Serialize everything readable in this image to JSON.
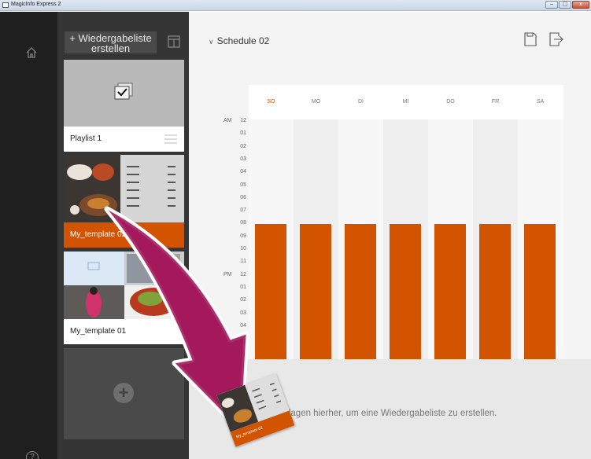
{
  "window": {
    "title": "MagicInfo Express 2",
    "buttons": [
      "–",
      "▢",
      "x"
    ]
  },
  "rail": {
    "home_icon": "home-icon",
    "help_label": "?"
  },
  "playlists": {
    "add_label": "+ Wiedergabeliste erstellen",
    "items": [
      {
        "label": "Playlist 1"
      },
      {
        "label": "My_template 02",
        "selected": true
      },
      {
        "label": "My_template 01"
      }
    ],
    "add_icon_label": "+"
  },
  "schedule": {
    "title": "Schedule 02",
    "days": [
      "SO",
      "MO",
      "DI",
      "MI",
      "DO",
      "FR",
      "SA"
    ],
    "ampm": {
      "am": "AM",
      "pm": "PM"
    },
    "hours_am": [
      "12",
      "01",
      "02",
      "03",
      "04",
      "05",
      "06",
      "07",
      "08",
      "09",
      "10",
      "11"
    ],
    "hours_pm": [
      "12",
      "01",
      "02",
      "03",
      "04"
    ],
    "drop_text": "e Vorlagen hierher, um eine Wiedergabeliste zu erstellen."
  },
  "drag": {
    "label": "My_template 02"
  },
  "colors": {
    "accent": "#d35400",
    "rail": "#1f1f1f",
    "panel": "#353535"
  }
}
